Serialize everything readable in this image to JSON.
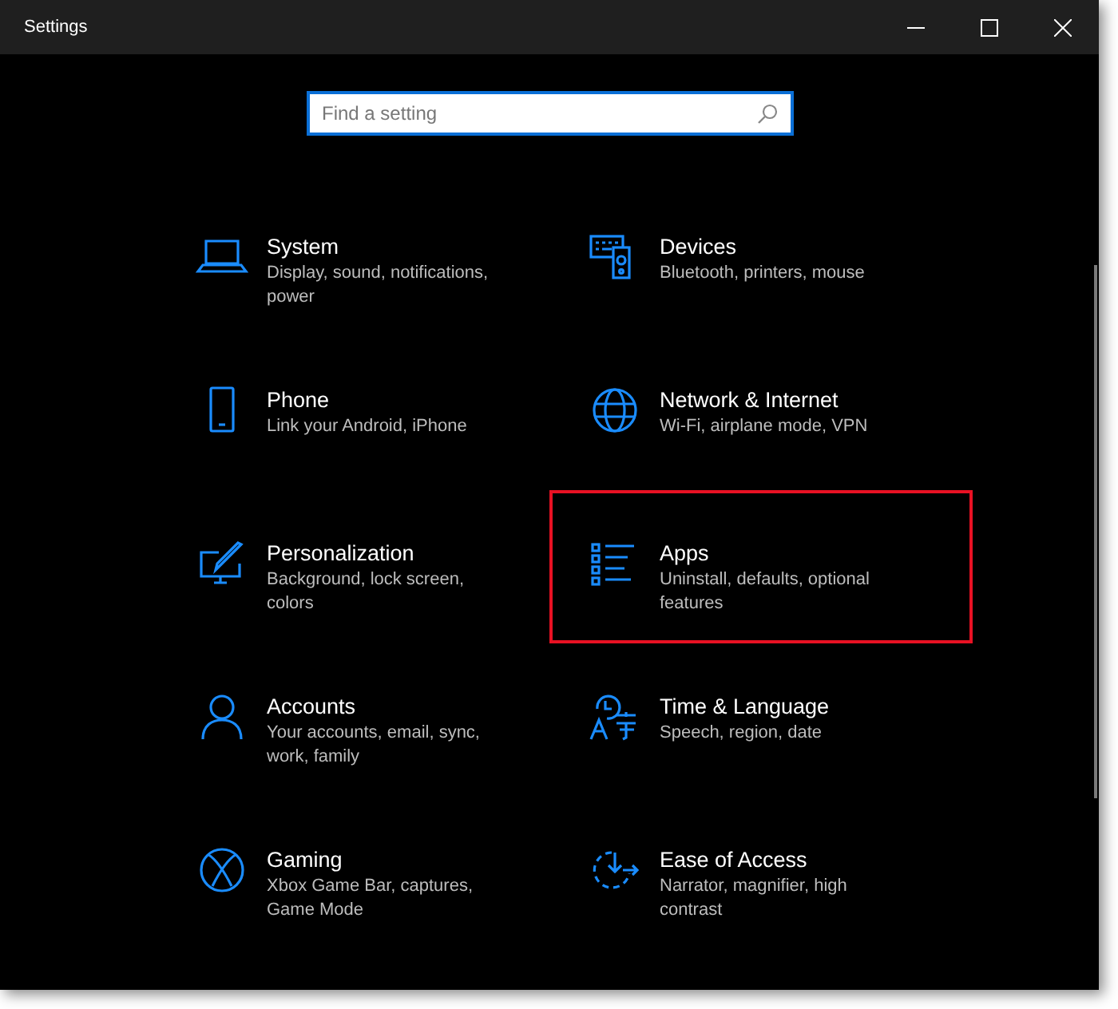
{
  "window": {
    "title": "Settings"
  },
  "search": {
    "placeholder": "Find a setting"
  },
  "categories": [
    {
      "kind": "system",
      "title": "System",
      "description": "Display, sound, notifications, power",
      "highlighted": false
    },
    {
      "kind": "devices",
      "title": "Devices",
      "description": "Bluetooth, printers, mouse",
      "highlighted": false
    },
    {
      "kind": "phone",
      "title": "Phone",
      "description": "Link your Android, iPhone",
      "highlighted": false
    },
    {
      "kind": "network",
      "title": "Network & Internet",
      "description": "Wi-Fi, airplane mode, VPN",
      "highlighted": false
    },
    {
      "kind": "personalization",
      "title": "Personalization",
      "description": "Background, lock screen, colors",
      "highlighted": false
    },
    {
      "kind": "apps",
      "title": "Apps",
      "description": "Uninstall, defaults, optional features",
      "highlighted": true
    },
    {
      "kind": "accounts",
      "title": "Accounts",
      "description": "Your accounts, email, sync, work, family",
      "highlighted": false
    },
    {
      "kind": "time",
      "title": "Time & Language",
      "description": "Speech, region, date",
      "highlighted": false
    },
    {
      "kind": "gaming",
      "title": "Gaming",
      "description": "Xbox Game Bar, captures, Game Mode",
      "highlighted": false
    },
    {
      "kind": "ease",
      "title": "Ease of Access",
      "description": "Narrator, magnifier, high contrast",
      "highlighted": false
    }
  ]
}
